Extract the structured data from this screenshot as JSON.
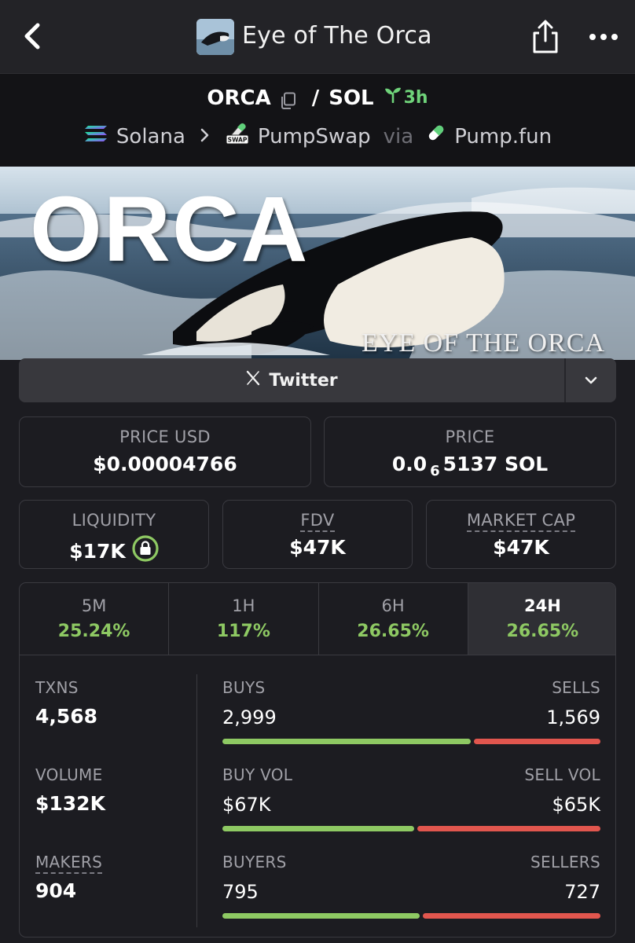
{
  "topbar": {
    "title": "Eye of The Orca",
    "icons": [
      "back-chevron-icon",
      "token-avatar",
      "share-icon",
      "more-dots-icon"
    ]
  },
  "pair": {
    "base": "ORCA",
    "quote": "SOL",
    "separator": "/",
    "age": "3h",
    "chain": "Solana",
    "dex": "PumpSwap",
    "via": "via",
    "launchpad": "Pump.fun"
  },
  "banner": {
    "title": "ORCA",
    "tagline": "EYE OF THE ORCA"
  },
  "links": {
    "twitter_label": "Twitter"
  },
  "stats": {
    "price_usd_label": "PRICE USD",
    "price_usd_value": "$0.00004766",
    "price_label": "PRICE",
    "price_prefix": "0.0",
    "price_zeros": "6",
    "price_suffix": "5137 SOL",
    "liquidity_label": "LIQUIDITY",
    "liquidity_value": "$17K",
    "fdv_label": "FDV",
    "fdv_value": "$47K",
    "mcap_label": "MARKET CAP",
    "mcap_value": "$47K"
  },
  "timeframes": [
    {
      "label": "5M",
      "change": "25.24%"
    },
    {
      "label": "1H",
      "change": "117%"
    },
    {
      "label": "6H",
      "change": "26.65%"
    },
    {
      "label": "24H",
      "change": "26.65%",
      "active": true
    }
  ],
  "activity": {
    "txns_label": "TXNS",
    "txns_value": "4,568",
    "volume_label": "VOLUME",
    "volume_value": "$132K",
    "makers_label": "MAKERS",
    "makers_value": "904",
    "buys_label": "BUYS",
    "buys_value": "2,999",
    "sells_label": "SELLS",
    "sells_value": "1,569",
    "buy_share": 0.657,
    "buyvol_label": "BUY VOL",
    "buyvol_value": "$67K",
    "sellvol_label": "SELL VOL",
    "sellvol_value": "$65K",
    "buyvol_share": 0.508,
    "buyers_label": "BUYERS",
    "buyers_value": "795",
    "sellers_label": "SELLERS",
    "sellers_value": "727",
    "buyers_share": 0.522
  },
  "colors": {
    "positive": "#8ec963",
    "negative": "#e1564e",
    "background": "#1c1c21"
  }
}
